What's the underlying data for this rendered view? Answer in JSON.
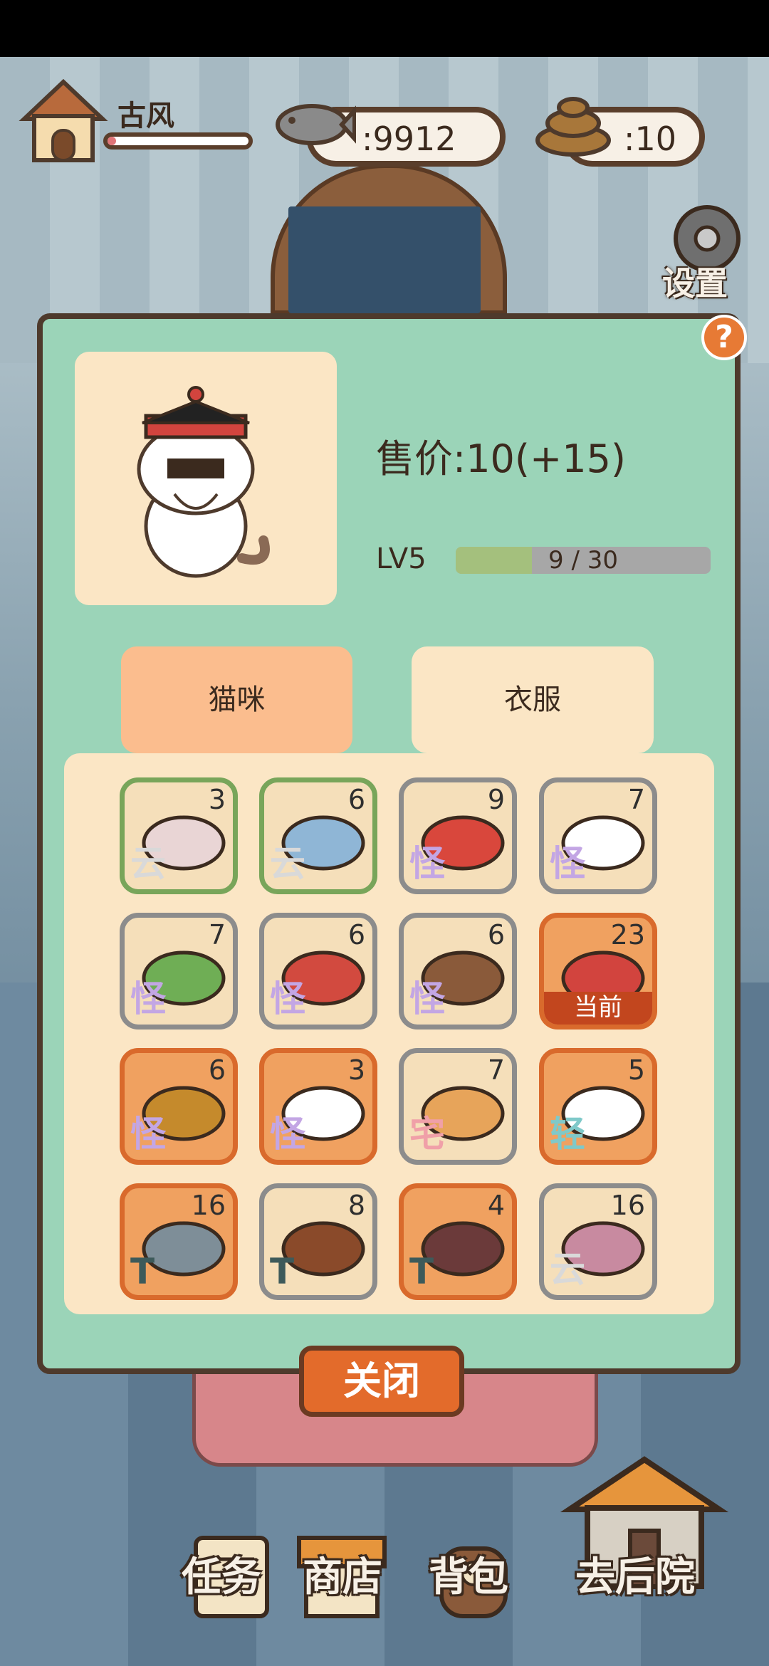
{
  "header": {
    "level_name": "古风",
    "level_progress": 0.06,
    "fish_count": ":9912",
    "poop_count": ":10"
  },
  "settings_label": "设置",
  "help_symbol": "?",
  "detail": {
    "price": "售价:10(+15)",
    "level": "LV5",
    "exp_text": "9 / 30",
    "exp_current": 9,
    "exp_max": 30
  },
  "tabs": [
    {
      "label": "猫咪",
      "active": true
    },
    {
      "label": "衣服",
      "active": false
    }
  ],
  "items": [
    {
      "count": "3",
      "tag": "云",
      "tag_color": "#d9d9d9",
      "frame": "green",
      "name": "robe-icon"
    },
    {
      "count": "6",
      "tag": "云",
      "tag_color": "#d9d9d9",
      "frame": "green",
      "name": "blue-jacket-icon"
    },
    {
      "count": "9",
      "tag": "怪",
      "tag_color": "#c3a6e4",
      "frame": "gray",
      "name": "red-armor-icon"
    },
    {
      "count": "7",
      "tag": "怪",
      "tag_color": "#c3a6e4",
      "frame": "gray",
      "name": "white-scarf-icon"
    },
    {
      "count": "7",
      "tag": "怪",
      "tag_color": "#c3a6e4",
      "frame": "gray",
      "name": "watermelon-hat-icon"
    },
    {
      "count": "6",
      "tag": "怪",
      "tag_color": "#c3a6e4",
      "frame": "gray",
      "name": "lips-icon"
    },
    {
      "count": "6",
      "tag": "怪",
      "tag_color": "#c3a6e4",
      "frame": "gray",
      "name": "plunger-icon"
    },
    {
      "count": "23",
      "tag": "",
      "tag_color": "#c3a6e4",
      "frame": "orange",
      "name": "official-hat-icon",
      "current": "当前"
    },
    {
      "count": "6",
      "tag": "怪",
      "tag_color": "#c3a6e4",
      "frame": "orange",
      "name": "pumpkin-hat-icon"
    },
    {
      "count": "3",
      "tag": "怪",
      "tag_color": "#c3a6e4",
      "frame": "orange",
      "name": "hero-helmet-icon"
    },
    {
      "count": "7",
      "tag": "宅",
      "tag_color": "#f0a0a8",
      "frame": "gray",
      "name": "slipper-icon"
    },
    {
      "count": "5",
      "tag": "轻",
      "tag_color": "#7fc9c9",
      "frame": "orange",
      "name": "bowtie-collar-icon"
    },
    {
      "count": "16",
      "tag": "T",
      "tag_color": "#3d5a5a",
      "frame": "orange",
      "name": "spiked-helmet-icon"
    },
    {
      "count": "8",
      "tag": "T",
      "tag_color": "#3d5a5a",
      "frame": "gray",
      "name": "pipe-icon"
    },
    {
      "count": "4",
      "tag": "T",
      "tag_color": "#3d5a5a",
      "frame": "orange",
      "name": "wings-icon"
    },
    {
      "count": "16",
      "tag": "云",
      "tag_color": "#d9d9d9",
      "frame": "gray",
      "name": "flower-hairpin-icon"
    }
  ],
  "close_label": "关闭",
  "bottom_nav": [
    {
      "label": "任务"
    },
    {
      "label": "商店"
    },
    {
      "label": "背包"
    },
    {
      "label": "去后院"
    }
  ]
}
